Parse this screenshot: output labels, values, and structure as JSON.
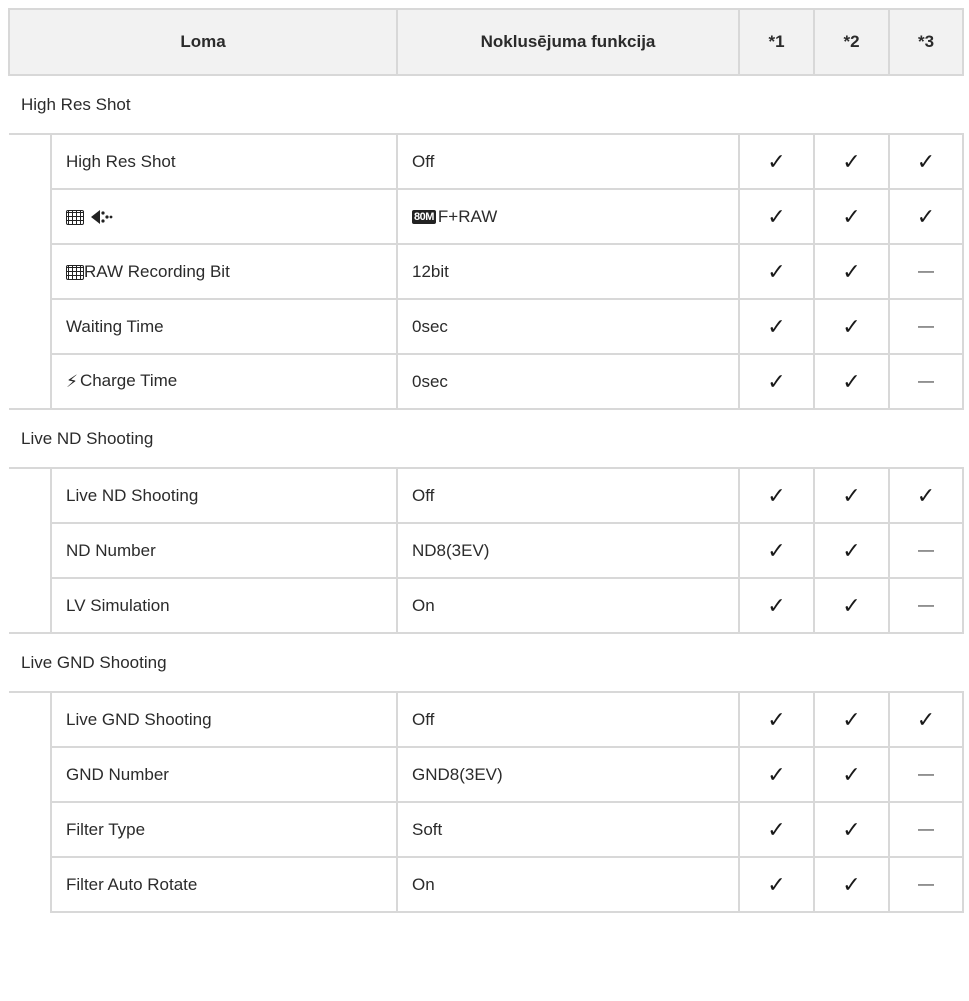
{
  "headers": {
    "role": "Loma",
    "default": "Noklusējuma funkcija",
    "c1": "*1",
    "c2": "*2",
    "c3": "*3"
  },
  "marks": {
    "check": "✓",
    "dash": "—"
  },
  "sections": [
    {
      "title": "High Res Shot",
      "rows": [
        {
          "name": "High Res Shot",
          "value": "Off",
          "c": [
            "check",
            "check",
            "check"
          ]
        },
        {
          "name": "",
          "name_icons": [
            "grid-icon",
            "quality-icon"
          ],
          "value_badge": "80M",
          "value": "F+RAW",
          "c": [
            "check",
            "check",
            "check"
          ]
        },
        {
          "name": "RAW Recording Bit",
          "name_icons": [
            "grid-icon"
          ],
          "value": "12bit",
          "c": [
            "check",
            "check",
            "dash"
          ]
        },
        {
          "name": "Waiting Time",
          "value": "0sec",
          "c": [
            "check",
            "check",
            "dash"
          ]
        },
        {
          "name": "Charge Time",
          "name_icons": [
            "flash-icon"
          ],
          "value": "0sec",
          "c": [
            "check",
            "check",
            "dash"
          ]
        }
      ]
    },
    {
      "title": "Live ND Shooting",
      "rows": [
        {
          "name": "Live ND Shooting",
          "value": "Off",
          "c": [
            "check",
            "check",
            "check"
          ]
        },
        {
          "name": "ND Number",
          "value": "ND8(3EV)",
          "c": [
            "check",
            "check",
            "dash"
          ]
        },
        {
          "name": "LV Simulation",
          "value": "On",
          "c": [
            "check",
            "check",
            "dash"
          ]
        }
      ]
    },
    {
      "title": "Live GND Shooting",
      "rows": [
        {
          "name": "Live GND Shooting",
          "value": "Off",
          "c": [
            "check",
            "check",
            "check"
          ]
        },
        {
          "name": "GND Number",
          "value": "GND8(3EV)",
          "c": [
            "check",
            "check",
            "dash"
          ]
        },
        {
          "name": "Filter Type",
          "value": "Soft",
          "c": [
            "check",
            "check",
            "dash"
          ]
        },
        {
          "name": "Filter Auto Rotate",
          "value": "On",
          "c": [
            "check",
            "check",
            "dash"
          ]
        }
      ]
    }
  ]
}
